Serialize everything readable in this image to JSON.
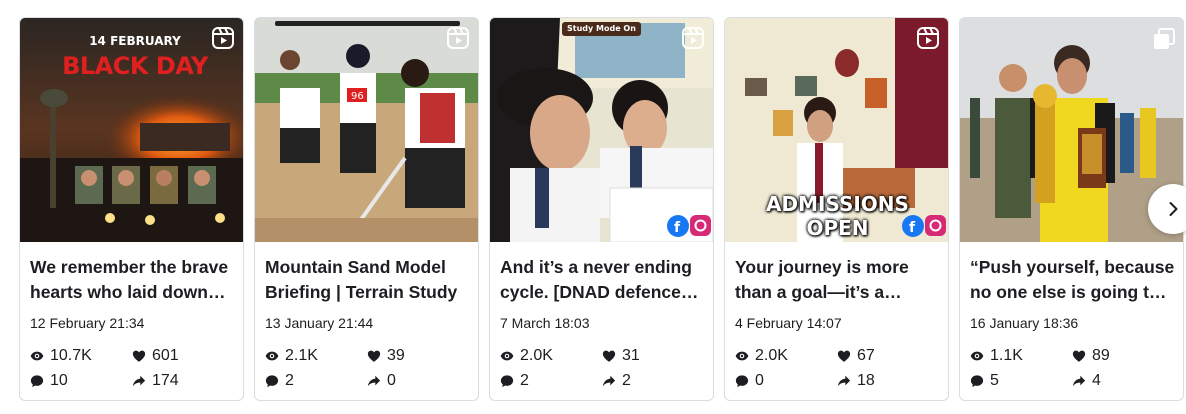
{
  "posts": [
    {
      "overlay": {
        "line1": "14 FEBRUARY",
        "line2": "BLACK DAY"
      },
      "type_icon": "reel-icon",
      "caption": "We remember the brave hearts who laid down their lives",
      "date": "12 February 21:34",
      "views": "10.7K",
      "likes": "601",
      "comments": "10",
      "shares": "174"
    },
    {
      "overlay": {
        "bib": "96"
      },
      "type_icon": "reel-icon",
      "caption": "Mountain Sand Model Briefing | Terrain Study",
      "date": "13 January 21:44",
      "views": "2.1K",
      "likes": "39",
      "comments": "2",
      "shares": "0"
    },
    {
      "overlay": {
        "tag": "Study Mode On"
      },
      "type_icon": "reel-icon",
      "caption": "And it’s a never ending cycle. [DNAD defence academy]",
      "date": "7 March 18:03",
      "views": "2.0K",
      "likes": "31",
      "comments": "2",
      "shares": "2"
    },
    {
      "overlay": {
        "line1": "ADMISSIONS",
        "line2": "OPEN"
      },
      "type_icon": "reel-icon",
      "caption": "Your journey is more than a goal—it’s a mission",
      "date": "4 February 14:07",
      "views": "2.0K",
      "likes": "67",
      "comments": "0",
      "shares": "18"
    },
    {
      "overlay": {},
      "type_icon": "carousel-icon",
      "caption": "“Push yourself, because no one else is going to do it for you”",
      "date": "16 January 18:36",
      "views": "1.1K",
      "likes": "89",
      "comments": "5",
      "shares": "4"
    }
  ],
  "icons": {
    "views": "eye-icon",
    "likes": "heart-icon",
    "comments": "comment-icon",
    "shares": "share-icon",
    "next": "chevron-right-icon"
  },
  "colors": {
    "text": "#1c1e21",
    "border": "#dadde1",
    "facebook": "#1877f2",
    "instagram": "#d62976",
    "black_day_red": "#e02020"
  }
}
